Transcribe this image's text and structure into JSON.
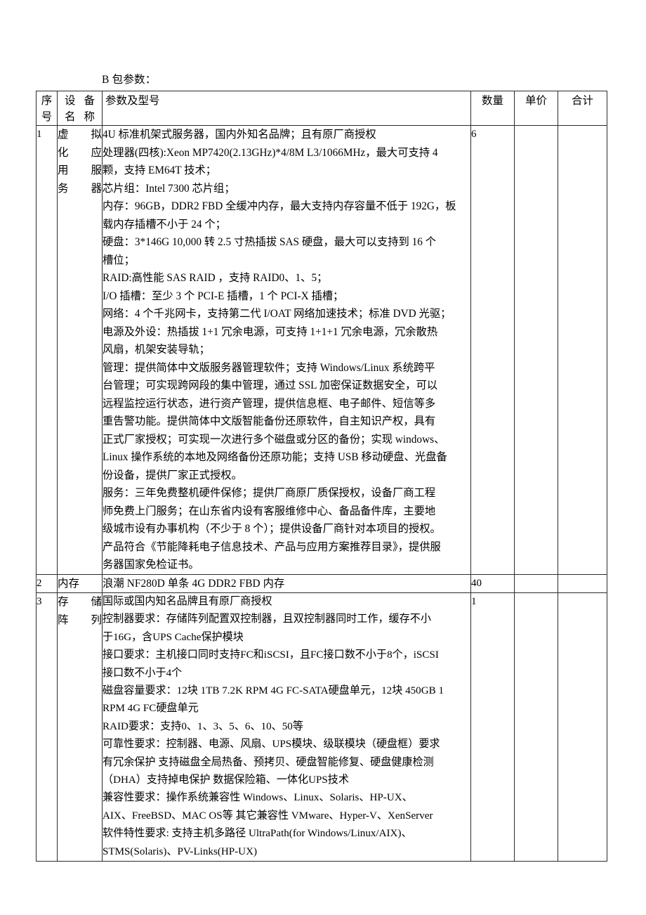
{
  "document": {
    "caption": "B 包参数："
  },
  "table": {
    "headers": {
      "no": "序号",
      "no_lines": [
        "序",
        "号"
      ],
      "name": "设备名称",
      "name_lines": [
        "设 备",
        "名 称"
      ],
      "spec": "参数及型号",
      "qty": "数量",
      "price": "单价",
      "total": "合计"
    },
    "rows": [
      {
        "no": "1",
        "name": "虚拟化应用服务器",
        "name_lines": [
          "虚 拟",
          "化 应",
          "用 服",
          "务 器"
        ],
        "qty": "6",
        "price": "",
        "total": "",
        "spec_lines": [
          "4U 标准机架式服务器，国内外知名品牌；且有原厂商授权",
          "处理器(四核):Xeon MP7420(2.13GHz)*4/8M L3/1066MHz，最大可支持 4",
          "颗，支持 EM64T 技术；",
          "芯片组：Intel 7300 芯片组；",
          "内存：96GB，DDR2 FBD 全缓冲内存，最大支持内存容量不低于 192G，板",
          "载内存插槽不小于 24 个；",
          "硬盘：3*146G 10,000 转 2.5 寸热插拔 SAS 硬盘，最大可以支持到 16 个",
          "槽位；",
          "RAID:高性能 SAS RAID ，支持 RAID0、1、5；",
          "I/O 插槽：至少 3 个 PCI-E 插槽，1 个 PCI-X 插槽；",
          "网络：4 个千兆网卡，支持第二代 I/OAT 网络加速技术；标准 DVD 光驱；",
          "电源及外设：热插拔 1+1 冗余电源，可支持 1+1+1 冗余电源，冗余散热",
          "风扇，机架安装导轨；",
          "管理：提供简体中文版服务器管理软件；支持 Windows/Linux 系统跨平",
          "台管理；可实现跨网段的集中管理，通过 SSL 加密保证数据安全，可以",
          "远程监控运行状态，进行资产管理，提供信息框、电子邮件、短信等多",
          "重告警功能。提供简体中文版智能备份还原软件，自主知识产权，具有",
          "正式厂家授权；可实现一次进行多个磁盘或分区的备份；实现 windows、",
          "Linux 操作系统的本地及网络备份还原功能；支持 USB 移动硬盘、光盘备",
          "份设备，提供厂家正式授权。",
          "服务：三年免费整机硬件保修；提供厂商原厂质保授权，设备厂商工程",
          "师免费上门服务；在山东省内设有客服维修中心、备品备件库，主要地",
          "级城市设有办事机构（不少于 8 个）；提供设备厂商针对本项目的授权。",
          "产品符合《节能降耗电子信息技术、产品与应用方案推荐目录》，提供服",
          "务器国家免检证书。"
        ]
      },
      {
        "no": "2",
        "name": "内存",
        "name_lines": [
          "内存"
        ],
        "qty": "40",
        "price": "",
        "total": "",
        "spec_lines": [
          "浪潮 NF280D 单条 4G DDR2 FBD 内存"
        ]
      },
      {
        "no": "3",
        "name": "存储阵列",
        "name_lines": [
          "存 储",
          "阵 列"
        ],
        "qty": "1",
        "price": "",
        "total": "",
        "spec_lines": [
          "国际或国内知名品牌且有原厂商授权",
          "控制器要求：存储阵列配置双控制器，且双控制器同时工作，缓存不小",
          "于16G，含UPS Cache保护模块",
          "接口要求：主机接口同时支持FC和iSCSI，且FC接口数不小于8个，iSCSI",
          "接口数不小于4个",
          "磁盘容量要求：12块 1TB 7.2K RPM 4G FC-SATA硬盘单元，12块 450GB 1",
          "RPM 4G FC硬盘单元",
          "RAID要求：支持0、1、3、5、6、10、50等",
          "可靠性要求：控制器、电源、风扇、UPS模块、级联模块（硬盘框）要求",
          "有冗余保护 支持磁盘全局热备、预拷贝、硬盘智能修复、硬盘健康检测",
          "（DHA）支持掉电保护 数据保险箱、一体化UPS技术",
          "兼容性要求：操作系统兼容性  Windows、Linux、Solaris、HP-UX、",
          "AIX、FreeBSD、MAC OS等 其它兼容性   VMware、Hyper-V、XenServer",
          "软件特性要求: 支持主机多路径    UltraPath(for Windows/Linux/AIX)、",
          "STMS(Solaris)、PV-Links(HP-UX)"
        ]
      }
    ]
  }
}
